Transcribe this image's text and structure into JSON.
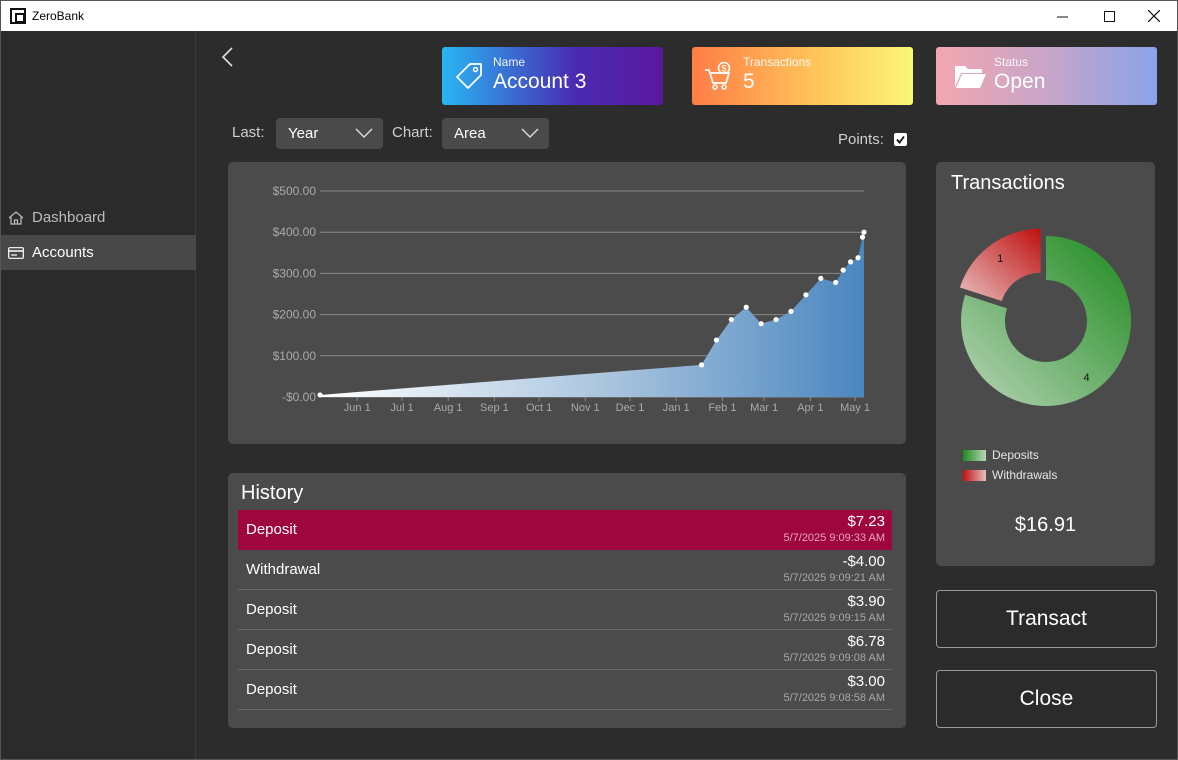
{
  "window": {
    "title": "ZeroBank",
    "minimize": "—",
    "maximize": "☐",
    "close": "✕"
  },
  "sidebar": {
    "items": [
      {
        "label": "Dashboard",
        "icon": "home-icon",
        "selected": false
      },
      {
        "label": "Accounts",
        "icon": "credit-card-icon",
        "selected": true
      }
    ]
  },
  "cards": {
    "name": {
      "label": "Name",
      "value": "Account 3",
      "icon": "tag-icon"
    },
    "transactions": {
      "label": "Transactions",
      "value": "5",
      "icon": "shopping-cart-icon"
    },
    "status": {
      "label": "Status",
      "value": "Open",
      "icon": "folder-open-icon"
    }
  },
  "filters": {
    "last_label": "Last:",
    "last_value": "Year",
    "chart_label": "Chart:",
    "chart_value": "Area",
    "points_label": "Points:",
    "points_checked": true,
    "checkmark": "✔"
  },
  "chart_data": [
    {
      "type": "area",
      "title": "",
      "xlabel": "",
      "ylabel": "",
      "ylim": [
        0,
        500
      ],
      "y_ticks": [
        "-$0.00",
        "$100.00",
        "$200.00",
        "$300.00",
        "$400.00",
        "$500.00"
      ],
      "y_tick_values": [
        0,
        100,
        200,
        300,
        400,
        500
      ],
      "x_ticks": [
        "Jun 1",
        "Jul 1",
        "Aug 1",
        "Sep 1",
        "Oct 1",
        "Nov 1",
        "Dec 1",
        "Jan 1",
        "Feb 1",
        "Mar 1",
        "Apr 1",
        "May 1"
      ],
      "x_tick_values": [
        "2024-06-01",
        "2024-07-01",
        "2024-08-01",
        "2024-09-01",
        "2024-10-01",
        "2024-11-01",
        "2024-12-01",
        "2025-01-01",
        "2025-02-01",
        "2025-03-01",
        "2025-04-01",
        "2025-05-01"
      ],
      "x_range": [
        "2024-05-07",
        "2025-05-07"
      ],
      "grid": true,
      "points_visible": true,
      "color": "#4a86c0",
      "series": [
        {
          "x": [
            "2024-05-07",
            "2025-01-18",
            "2025-01-28",
            "2025-02-07",
            "2025-02-17",
            "2025-02-27",
            "2025-03-09",
            "2025-03-19",
            "2025-03-29",
            "2025-04-08",
            "2025-04-18",
            "2025-04-23",
            "2025-04-28",
            "2025-05-03",
            "2025-05-06",
            "2025-05-07"
          ],
          "values": [
            5,
            78,
            138,
            188,
            218,
            178,
            188,
            208,
            248,
            288,
            278,
            308,
            328,
            338,
            388,
            400
          ]
        }
      ]
    },
    {
      "type": "pie",
      "title": "Transactions",
      "categories": [
        "Deposits",
        "Withdrawals"
      ],
      "values": [
        4,
        1
      ],
      "data_labels": [
        "4",
        "1"
      ],
      "colors": [
        "#1f8a1f",
        "#c01010"
      ],
      "legend_position": "bottom-left"
    }
  ],
  "transactions_panel": {
    "title": "Transactions",
    "total": "$16.91"
  },
  "history": {
    "title": "History",
    "rows": [
      {
        "type": "Deposit",
        "amount": "$7.23",
        "time": "5/7/2025 9:09:33 AM",
        "selected": true
      },
      {
        "type": "Withdrawal",
        "amount": "-$4.00",
        "time": "5/7/2025 9:09:21 AM",
        "selected": false
      },
      {
        "type": "Deposit",
        "amount": "$3.90",
        "time": "5/7/2025 9:09:15 AM",
        "selected": false
      },
      {
        "type": "Deposit",
        "amount": "$6.78",
        "time": "5/7/2025 9:09:08 AM",
        "selected": false
      },
      {
        "type": "Deposit",
        "amount": "$3.00",
        "time": "5/7/2025 9:08:58 AM",
        "selected": false
      }
    ]
  },
  "buttons": {
    "transact": "Transact",
    "close": "Close"
  }
}
